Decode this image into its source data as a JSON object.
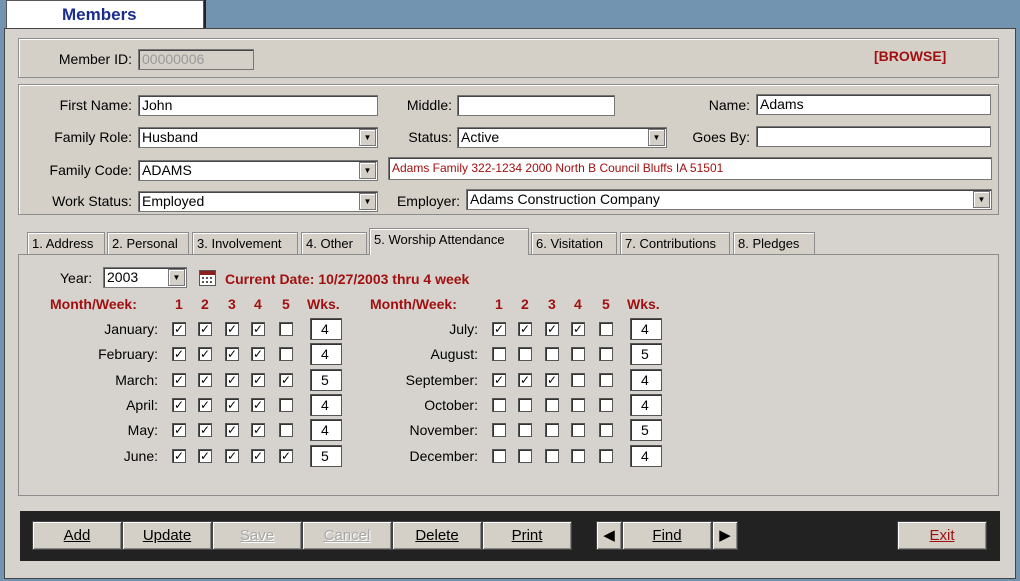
{
  "window": {
    "title": "Members"
  },
  "header": {
    "member_id_label": "Member ID:",
    "member_id_value": "00000006",
    "mode": "[BROWSE]"
  },
  "form": {
    "first_name_label": "First Name:",
    "first_name": "John",
    "middle_label": "Middle:",
    "middle": "",
    "name_label": "Name:",
    "name": "Adams",
    "family_role_label": "Family Role:",
    "family_role": "Husband",
    "status_label": "Status:",
    "status": "Active",
    "goes_by_label": "Goes By:",
    "goes_by": "",
    "family_code_label": "Family Code:",
    "family_code": "ADAMS",
    "family_info": "Adams Family 322-1234 2000 North B Council Bluffs IA 51501",
    "work_status_label": "Work Status:",
    "work_status": "Employed",
    "employer_label": "Employer:",
    "employer": "Adams Construction Company"
  },
  "tabs": [
    {
      "label": "1. Address"
    },
    {
      "label": "2. Personal"
    },
    {
      "label": "3. Involvement"
    },
    {
      "label": "4. Other"
    },
    {
      "label": "5. Worship Attendance"
    },
    {
      "label": "6. Visitation"
    },
    {
      "label": "7. Contributions"
    },
    {
      "label": "8. Pledges"
    }
  ],
  "attendance": {
    "year_label": "Year:",
    "year": "2003",
    "current_date": "Current Date: 10/27/2003 thru 4 week",
    "month_week_label": "Month/Week:",
    "week_numbers": [
      "1",
      "2",
      "3",
      "4",
      "5"
    ],
    "wks_label": "Wks.",
    "months": [
      {
        "name": "January:",
        "weeks": [
          true,
          true,
          true,
          true,
          false
        ],
        "wks": "4"
      },
      {
        "name": "February:",
        "weeks": [
          true,
          true,
          true,
          true,
          false
        ],
        "wks": "4"
      },
      {
        "name": "March:",
        "weeks": [
          true,
          true,
          true,
          true,
          true
        ],
        "wks": "5"
      },
      {
        "name": "April:",
        "weeks": [
          true,
          true,
          true,
          true,
          false
        ],
        "wks": "4"
      },
      {
        "name": "May:",
        "weeks": [
          true,
          true,
          true,
          true,
          false
        ],
        "wks": "4"
      },
      {
        "name": "June:",
        "weeks": [
          true,
          true,
          true,
          true,
          true
        ],
        "wks": "5"
      },
      {
        "name": "July:",
        "weeks": [
          true,
          true,
          true,
          true,
          false
        ],
        "wks": "4"
      },
      {
        "name": "August:",
        "weeks": [
          false,
          false,
          false,
          false,
          false
        ],
        "wks": "5"
      },
      {
        "name": "September:",
        "weeks": [
          true,
          true,
          true,
          false,
          false
        ],
        "wks": "4"
      },
      {
        "name": "October:",
        "weeks": [
          false,
          false,
          false,
          false,
          false
        ],
        "wks": "4"
      },
      {
        "name": "November:",
        "weeks": [
          false,
          false,
          false,
          false,
          false
        ],
        "wks": "5"
      },
      {
        "name": "December:",
        "weeks": [
          false,
          false,
          false,
          false,
          false
        ],
        "wks": "4"
      }
    ]
  },
  "buttons": {
    "add": "Add",
    "update": "Update",
    "save": "Save",
    "cancel": "Cancel",
    "delete": "Delete",
    "print": "Print",
    "find": "Find",
    "exit": "Exit"
  },
  "icons": {
    "calendar": "calendar-icon",
    "prev": "triangle-left-icon",
    "next": "triangle-right-icon",
    "dropdown": "chevron-down-icon"
  }
}
